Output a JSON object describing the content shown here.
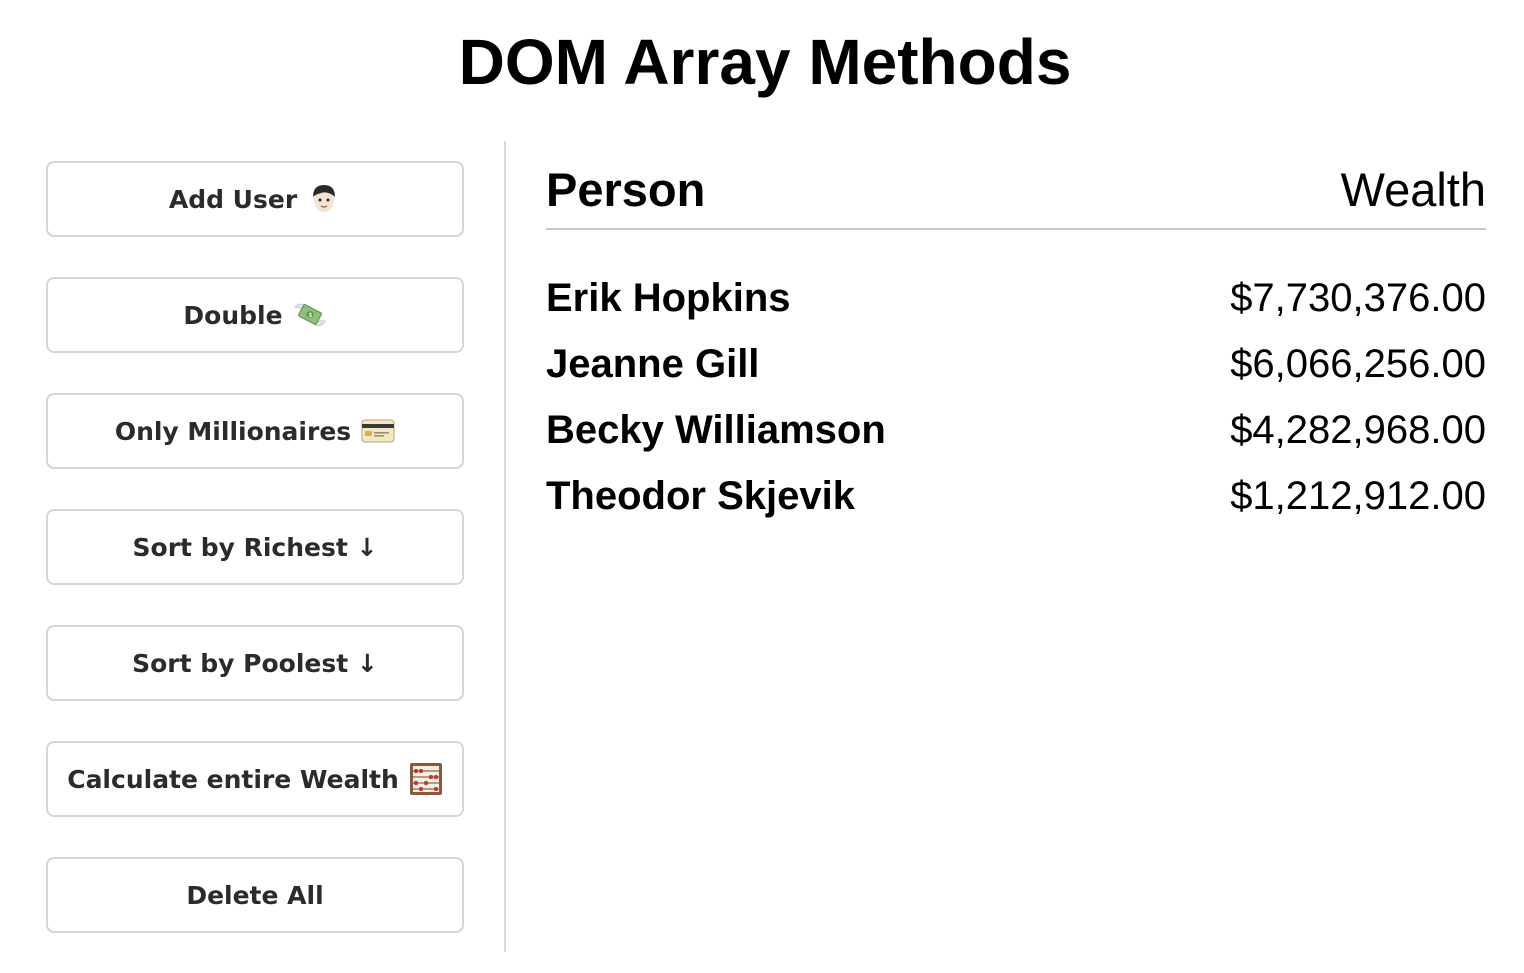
{
  "page": {
    "title": "DOM Array Methods"
  },
  "sidebar": {
    "buttons": [
      {
        "label": "Add User",
        "icon": "person-emoji-icon"
      },
      {
        "label": "Double",
        "icon": "money-wings-emoji-icon"
      },
      {
        "label": "Only Millionaires",
        "icon": "credit-card-emoji-icon"
      },
      {
        "label": "Sort by Richest ↓",
        "icon": ""
      },
      {
        "label": "Sort by Poolest ↓",
        "icon": ""
      },
      {
        "label": "Calculate entire Wealth",
        "icon": "abacus-emoji-icon"
      },
      {
        "label": "Delete All",
        "icon": ""
      }
    ]
  },
  "table": {
    "headers": {
      "person": "Person",
      "wealth": "Wealth"
    },
    "rows": [
      {
        "name": "Erik Hopkins",
        "wealth": "$7,730,376.00"
      },
      {
        "name": "Jeanne Gill",
        "wealth": "$6,066,256.00"
      },
      {
        "name": "Becky Williamson",
        "wealth": "$4,282,968.00"
      },
      {
        "name": "Theodor Skjevik",
        "wealth": "$1,212,912.00"
      }
    ]
  },
  "colors": {
    "button_border": "#d6d6d6",
    "button_text": "#2b2b2b",
    "divider": "#d9d9d9",
    "header_rule": "#c8c8c8"
  }
}
